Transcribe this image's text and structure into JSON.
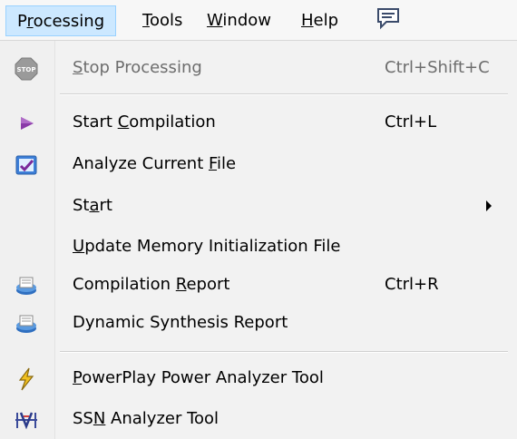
{
  "menubar": {
    "items": [
      {
        "pre": "P",
        "u": "r",
        "post": "ocessing"
      },
      {
        "pre": "",
        "u": "T",
        "post": "ools"
      },
      {
        "pre": "",
        "u": "W",
        "post": "indow"
      },
      {
        "pre": "",
        "u": "H",
        "post": "elp"
      }
    ],
    "extra_icon": "chat-bubble-icon"
  },
  "menu": {
    "items": [
      {
        "pre": "",
        "u": "S",
        "post": "top Processing",
        "shortcut": "Ctrl+Shift+C",
        "icon": "stop-icon",
        "icon_text": "STOP",
        "enabled": false
      },
      {
        "pre": "Start ",
        "u": "C",
        "post": "ompilation",
        "shortcut": "Ctrl+L",
        "icon": "play-icon"
      },
      {
        "pre": "Analyze Current ",
        "u": "F",
        "post": "ile",
        "shortcut": "",
        "icon": "analyze-file-icon"
      },
      {
        "pre": "St",
        "u": "a",
        "post": "rt",
        "shortcut": "",
        "icon": "",
        "submenu": true
      },
      {
        "pre": "",
        "u": "U",
        "post": "pdate Memory Initialization File",
        "shortcut": "",
        "icon": ""
      },
      {
        "pre": "Compilation ",
        "u": "R",
        "post": "eport",
        "shortcut": "Ctrl+R",
        "icon": "report-icon"
      },
      {
        "pre": "Dynamic Synthesis Report",
        "u": "",
        "post": "",
        "shortcut": "",
        "icon": "report-icon"
      },
      {
        "pre": "",
        "u": "P",
        "post": "owerPlay Power Analyzer Tool",
        "shortcut": "",
        "icon": "lightning-icon"
      },
      {
        "pre": "SS",
        "u": "N",
        "post": " Analyzer Tool",
        "shortcut": "",
        "icon": "ssn-icon"
      }
    ]
  }
}
